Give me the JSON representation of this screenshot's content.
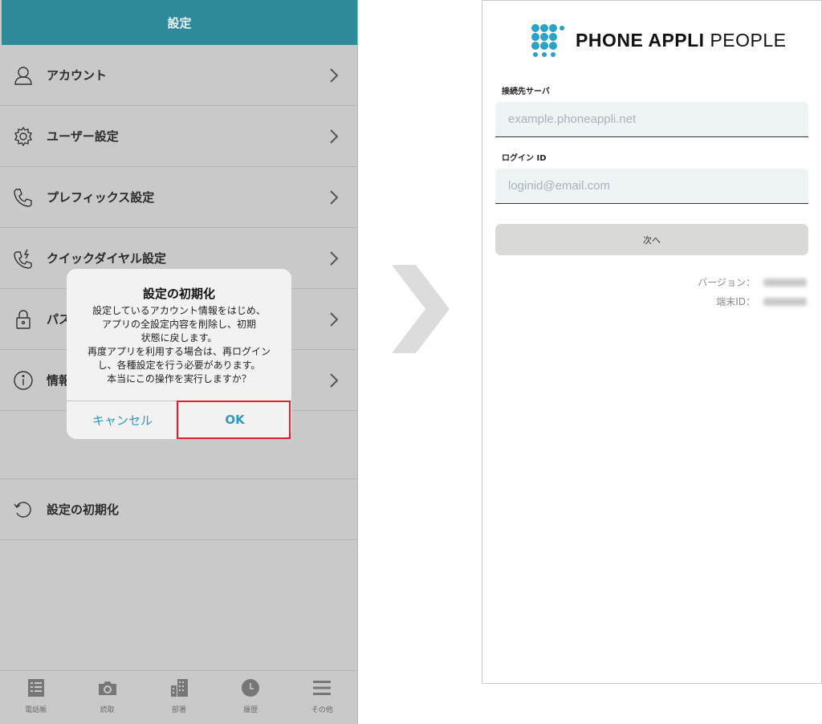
{
  "left_screen": {
    "header": {
      "title": "設定"
    },
    "menu": [
      {
        "label": "アカウント",
        "icon": "person-icon"
      },
      {
        "label": "ユーザー設定",
        "icon": "gear-icon"
      },
      {
        "label": "プレフィックス設定",
        "icon": "phone-icon"
      },
      {
        "label": "クイックダイヤル設定",
        "icon": "phone-quick-icon"
      },
      {
        "label": "パス",
        "icon": "lock-icon"
      },
      {
        "label": "情報",
        "icon": "info-icon"
      }
    ],
    "reset": {
      "label": "設定の初期化",
      "icon": "reset-icon"
    },
    "tabs": [
      {
        "label": "電話帳",
        "icon": "phonebook-icon"
      },
      {
        "label": "読取",
        "icon": "camera-icon"
      },
      {
        "label": "部署",
        "icon": "building-icon"
      },
      {
        "label": "履歴",
        "icon": "clock-icon"
      },
      {
        "label": "その他",
        "icon": "menu-icon"
      }
    ],
    "dialog": {
      "title": "設定の初期化",
      "message_lines": [
        "設定しているアカウント情報をはじめ、",
        "アプリの全設定内容を削除し、初期",
        "状態に戻します。",
        "再度アプリを利用する場合は、再ログイン",
        "し、各種設定を行う必要があります。",
        "本当にこの操作を実行しますか？"
      ],
      "cancel_label": "キャンセル",
      "ok_label": "OK"
    }
  },
  "right_screen": {
    "logo": {
      "bold": "PHONE APPLI",
      "light": "PEOPLE"
    },
    "server_label": "接続先サーバ",
    "server_placeholder": "example.phoneappli.net",
    "login_label": "ログイン ID",
    "login_placeholder": "loginid@email.com",
    "next_label": "次へ",
    "version_label": "バージョン：",
    "device_label": "端末ID："
  },
  "colors": {
    "header": "#2e8a9a",
    "link": "#2c9ac0",
    "highlight": "#d9232e",
    "logo_dots": "#2ba3c9"
  }
}
